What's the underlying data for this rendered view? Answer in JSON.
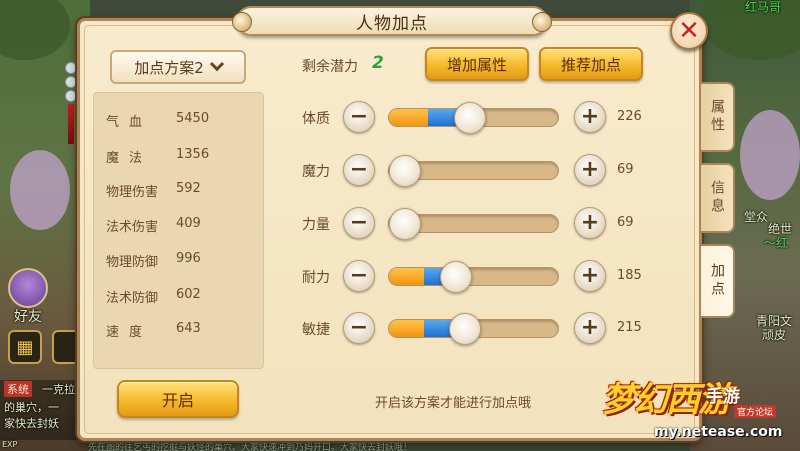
{
  "scene": {
    "labels_left": [
      "好友",
      "系统",
      "一克拉",
      "的巢穴，一",
      "家快去封妖"
    ],
    "labels_right": [
      "红马哥",
      "绝世",
      "～红",
      "青阳文",
      "顽皮",
      "堂众"
    ],
    "exp_label": "EXP",
    "bottom_text": "先在图的往乞丐的挖掘与妖怪的巢穴。大家快速冲到乃妈开口。大家快去封妖哦！"
  },
  "panel": {
    "title": "人物加点",
    "close_icon": "close-x-icon",
    "plan_select": {
      "label": "加点方案2"
    },
    "stats": [
      {
        "name": "气血",
        "value": "5450"
      },
      {
        "name": "魔法",
        "value": "1356"
      },
      {
        "name": "物理伤害",
        "value": "592"
      },
      {
        "name": "法术伤害",
        "value": "409"
      },
      {
        "name": "物理防御",
        "value": "996"
      },
      {
        "name": "法术防御",
        "value": "602"
      },
      {
        "name": "速度",
        "value": "643"
      }
    ],
    "open_button": "开启",
    "potential_label": "剩余潜力",
    "potential_value": "2",
    "add_attr_button": "增加属性",
    "recommend_button": "推荐加点",
    "attributes": [
      {
        "label": "体质",
        "value": "226",
        "orange_fraction": 0.23,
        "blue_fraction": 0.24,
        "knob_fraction": 0.48
      },
      {
        "label": "魔力",
        "value": "69",
        "orange_fraction": 0.1,
        "blue_fraction": 0.0,
        "knob_fraction": 0.1
      },
      {
        "label": "力量",
        "value": "69",
        "orange_fraction": 0.1,
        "blue_fraction": 0.0,
        "knob_fraction": 0.1
      },
      {
        "label": "耐力",
        "value": "185",
        "orange_fraction": 0.21,
        "blue_fraction": 0.17,
        "knob_fraction": 0.4
      },
      {
        "label": "敏捷",
        "value": "215",
        "orange_fraction": 0.21,
        "blue_fraction": 0.24,
        "knob_fraction": 0.45
      }
    ],
    "hint": "开启该方案才能进行加点哦",
    "tabs": [
      {
        "label": "属性",
        "active": false
      },
      {
        "label": "信息",
        "active": false
      },
      {
        "label": "加点",
        "active": true
      }
    ]
  },
  "logo": {
    "main": "梦幻西游",
    "sub": "手游",
    "sub2": "官方论坛",
    "url": "my.netease.com"
  },
  "colors": {
    "panel_bg": "#f6e6c3",
    "gold_button": "#f6b92c",
    "potential_green": "#29a43a",
    "close_red": "#d21f1f",
    "bar_orange": "#f39413",
    "bar_blue": "#1f6fd1"
  }
}
